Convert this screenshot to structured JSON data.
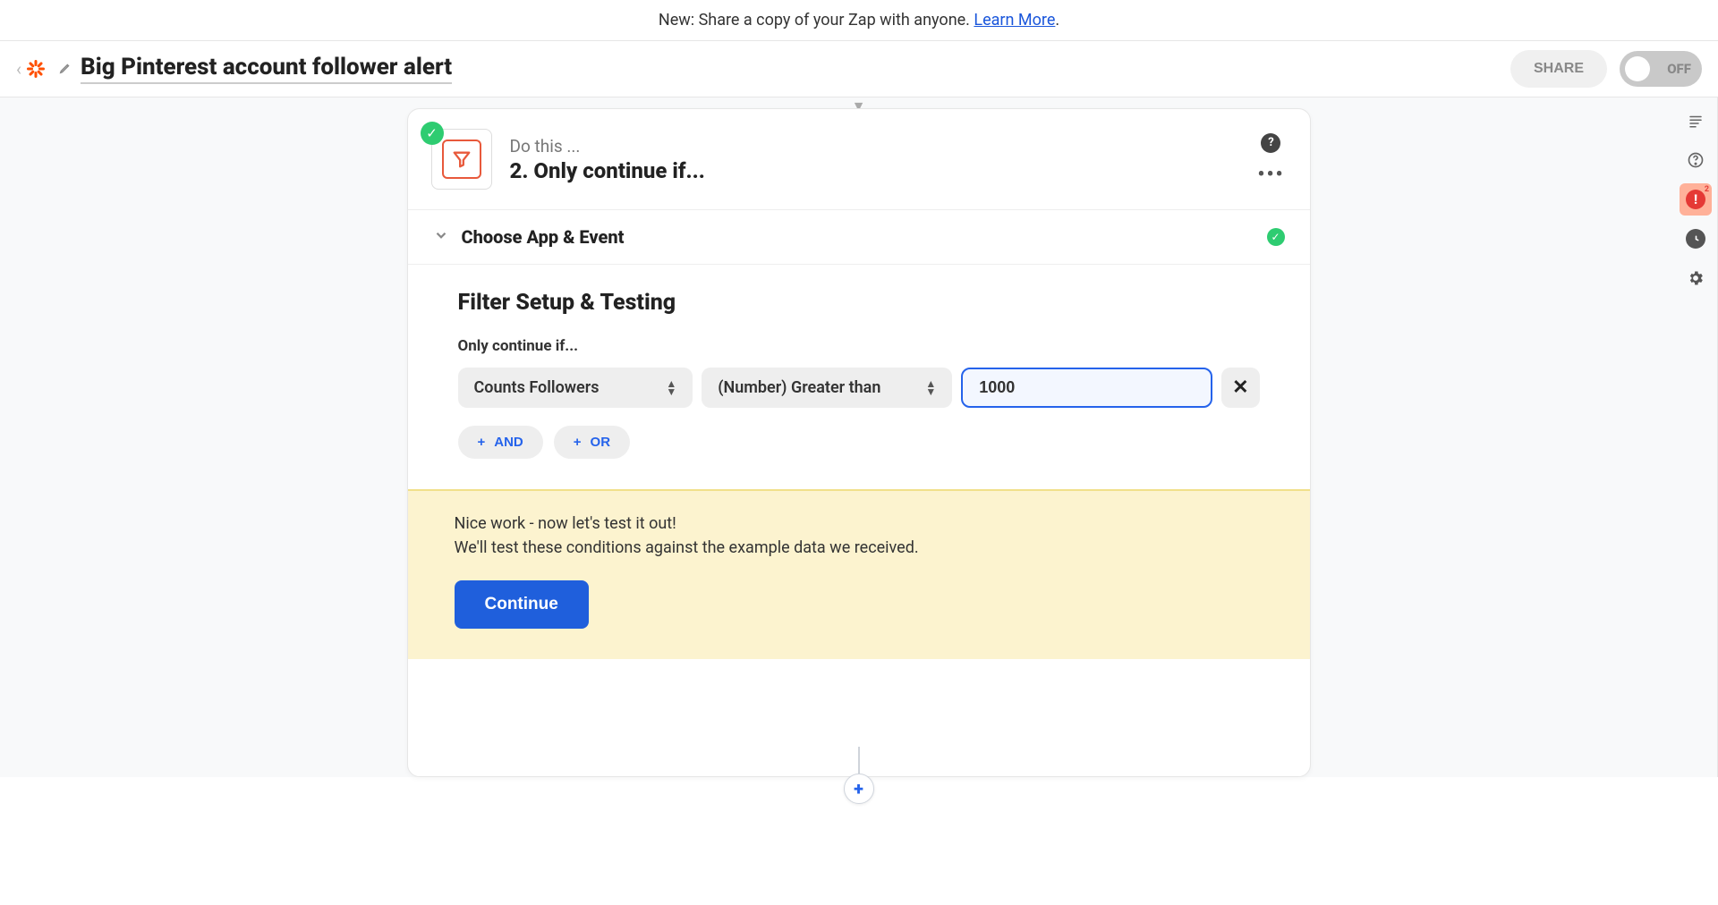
{
  "banner": {
    "text_prefix": "New: Share a copy of your Zap with anyone. ",
    "link_text": "Learn More",
    "suffix": "."
  },
  "header": {
    "zap_title": "Big Pinterest account follower alert",
    "share_label": "SHARE",
    "toggle_label": "OFF"
  },
  "rail": {
    "alert_count": "2"
  },
  "step": {
    "subtitle": "Do this ...",
    "title": "2. Only continue if...",
    "section_label": "Choose App & Event"
  },
  "filter": {
    "heading": "Filter Setup & Testing",
    "label": "Only continue if...",
    "field_value": "Counts Followers",
    "condition_value": "(Number) Greater than",
    "input_value": "1000",
    "and_label": "AND",
    "or_label": "OR"
  },
  "test": {
    "line1": "Nice work - now let's test it out!",
    "line2": "We'll test these conditions against the example data we received.",
    "continue_label": "Continue"
  }
}
